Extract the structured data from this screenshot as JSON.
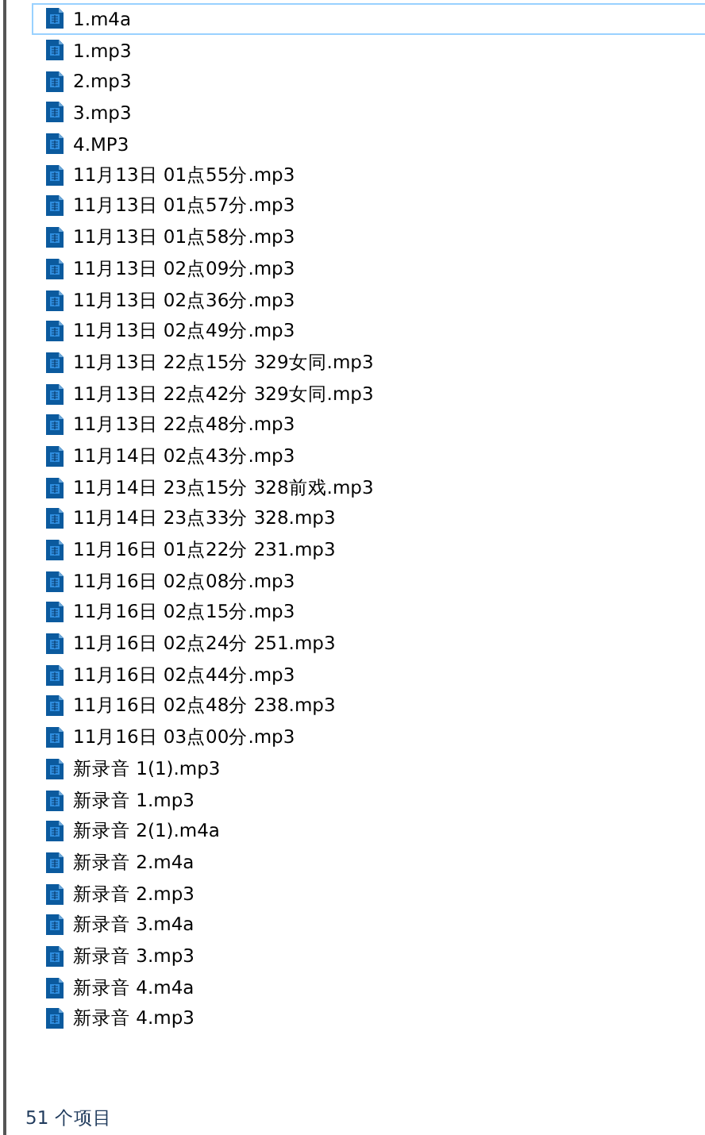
{
  "files": [
    {
      "name": "1.m4a",
      "focused": true
    },
    {
      "name": "1.mp3",
      "focused": false
    },
    {
      "name": "2.mp3",
      "focused": false
    },
    {
      "name": "3.mp3",
      "focused": false
    },
    {
      "name": "4.MP3",
      "focused": false
    },
    {
      "name": "11月13日 01点55分.mp3",
      "focused": false
    },
    {
      "name": "11月13日 01点57分.mp3",
      "focused": false
    },
    {
      "name": "11月13日 01点58分.mp3",
      "focused": false
    },
    {
      "name": "11月13日 02点09分.mp3",
      "focused": false
    },
    {
      "name": "11月13日 02点36分.mp3",
      "focused": false
    },
    {
      "name": "11月13日 02点49分.mp3",
      "focused": false
    },
    {
      "name": "11月13日 22点15分 329女同.mp3",
      "focused": false
    },
    {
      "name": "11月13日 22点42分 329女同.mp3",
      "focused": false
    },
    {
      "name": "11月13日 22点48分.mp3",
      "focused": false
    },
    {
      "name": "11月14日 02点43分.mp3",
      "focused": false
    },
    {
      "name": "11月14日 23点15分 328前戏.mp3",
      "focused": false
    },
    {
      "name": "11月14日 23点33分 328.mp3",
      "focused": false
    },
    {
      "name": "11月16日 01点22分 231.mp3",
      "focused": false
    },
    {
      "name": "11月16日 02点08分.mp3",
      "focused": false
    },
    {
      "name": "11月16日 02点15分.mp3",
      "focused": false
    },
    {
      "name": "11月16日 02点24分 251.mp3",
      "focused": false
    },
    {
      "name": "11月16日 02点44分.mp3",
      "focused": false
    },
    {
      "name": "11月16日 02点48分 238.mp3",
      "focused": false
    },
    {
      "name": "11月16日 03点00分.mp3",
      "focused": false
    },
    {
      "name": "新录音 1(1).mp3",
      "focused": false
    },
    {
      "name": "新录音 1.mp3",
      "focused": false
    },
    {
      "name": "新录音 2(1).m4a",
      "focused": false
    },
    {
      "name": "新录音 2.m4a",
      "focused": false
    },
    {
      "name": "新录音 2.mp3",
      "focused": false
    },
    {
      "name": "新录音 3.m4a",
      "focused": false
    },
    {
      "name": "新录音 3.mp3",
      "focused": false
    },
    {
      "name": "新录音 4.m4a",
      "focused": false
    },
    {
      "name": "新录音 4.mp3",
      "focused": false
    }
  ],
  "status_bar": {
    "item_count": "51 个项目"
  }
}
